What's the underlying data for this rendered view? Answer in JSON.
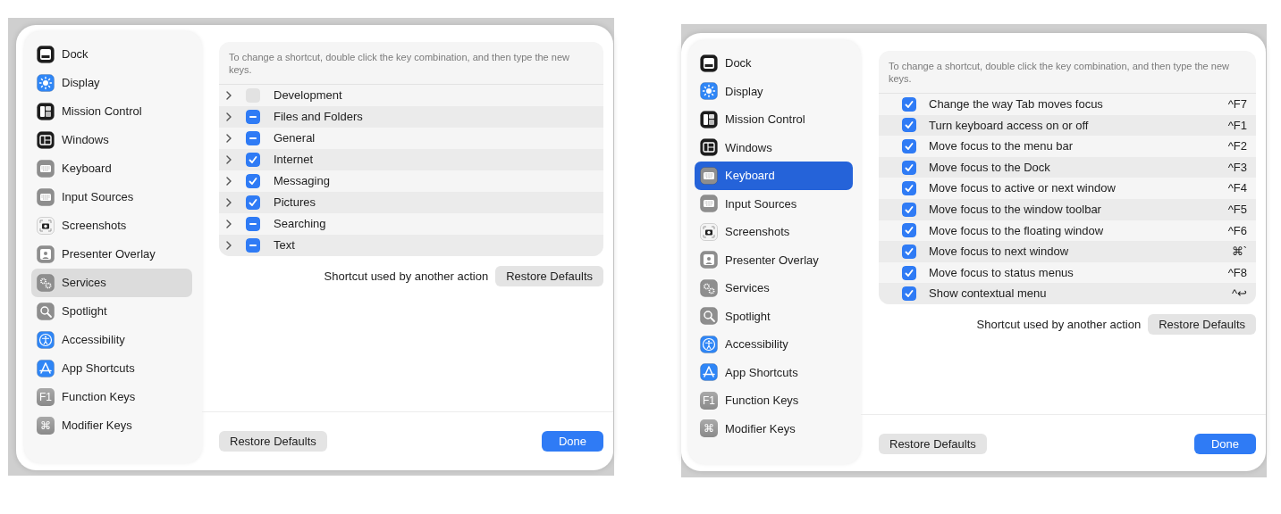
{
  "panels": [
    {
      "sidebar_focused": false,
      "sidebar": [
        {
          "label": "Dock",
          "selected": false
        },
        {
          "label": "Display",
          "selected": false
        },
        {
          "label": "Mission Control",
          "selected": false
        },
        {
          "label": "Windows",
          "selected": false
        },
        {
          "label": "Keyboard",
          "selected": false
        },
        {
          "label": "Input Sources",
          "selected": false
        },
        {
          "label": "Screenshots",
          "selected": false
        },
        {
          "label": "Presenter Overlay",
          "selected": false
        },
        {
          "label": "Services",
          "selected": true
        },
        {
          "label": "Spotlight",
          "selected": false
        },
        {
          "label": "Accessibility",
          "selected": false
        },
        {
          "label": "App Shortcuts",
          "selected": false
        },
        {
          "label": "Function Keys",
          "selected": false,
          "icon_glyph": "F1"
        },
        {
          "label": "Modifier Keys",
          "selected": false,
          "icon_glyph": "⌘"
        }
      ],
      "hint": "To change a shortcut, double click the key combination, and then type the new keys.",
      "rows": [
        {
          "kind": "group",
          "label": "Development",
          "checked": false,
          "mixed": false
        },
        {
          "kind": "group",
          "label": "Files and Folders",
          "checked": false,
          "mixed": true
        },
        {
          "kind": "group",
          "label": "General",
          "checked": false,
          "mixed": true
        },
        {
          "kind": "group",
          "label": "Internet",
          "checked": true,
          "mixed": false
        },
        {
          "kind": "group",
          "label": "Messaging",
          "checked": true,
          "mixed": false
        },
        {
          "kind": "group",
          "label": "Pictures",
          "checked": true,
          "mixed": false
        },
        {
          "kind": "group",
          "label": "Searching",
          "checked": false,
          "mixed": true
        },
        {
          "kind": "group",
          "label": "Text",
          "checked": false,
          "mixed": true
        }
      ],
      "footer_note": "Shortcut used by another action",
      "footer_button": "Restore Defaults",
      "bottom_left_button": "Restore Defaults",
      "done_button": "Done"
    },
    {
      "sidebar_focused": true,
      "sidebar": [
        {
          "label": "Dock",
          "selected": false
        },
        {
          "label": "Display",
          "selected": false
        },
        {
          "label": "Mission Control",
          "selected": false
        },
        {
          "label": "Windows",
          "selected": false
        },
        {
          "label": "Keyboard",
          "selected": true
        },
        {
          "label": "Input Sources",
          "selected": false
        },
        {
          "label": "Screenshots",
          "selected": false
        },
        {
          "label": "Presenter Overlay",
          "selected": false
        },
        {
          "label": "Services",
          "selected": false
        },
        {
          "label": "Spotlight",
          "selected": false
        },
        {
          "label": "Accessibility",
          "selected": false
        },
        {
          "label": "App Shortcuts",
          "selected": false
        },
        {
          "label": "Function Keys",
          "selected": false,
          "icon_glyph": "F1"
        },
        {
          "label": "Modifier Keys",
          "selected": false,
          "icon_glyph": "⌘"
        }
      ],
      "hint": "To change a shortcut, double click the key combination, and then type the new keys.",
      "rows": [
        {
          "kind": "shortcut",
          "label": "Change the way Tab moves focus",
          "checked": true,
          "mixed": false,
          "shortcut": "^F7"
        },
        {
          "kind": "shortcut",
          "label": "Turn keyboard access on or off",
          "checked": true,
          "mixed": false,
          "shortcut": "^F1"
        },
        {
          "kind": "shortcut",
          "label": "Move focus to the menu bar",
          "checked": true,
          "mixed": false,
          "shortcut": "^F2"
        },
        {
          "kind": "shortcut",
          "label": "Move focus to the Dock",
          "checked": true,
          "mixed": false,
          "shortcut": "^F3"
        },
        {
          "kind": "shortcut",
          "label": "Move focus to active or next window",
          "checked": true,
          "mixed": false,
          "shortcut": "^F4"
        },
        {
          "kind": "shortcut",
          "label": "Move focus to the window toolbar",
          "checked": true,
          "mixed": false,
          "shortcut": "^F5"
        },
        {
          "kind": "shortcut",
          "label": "Move focus to the floating window",
          "checked": true,
          "mixed": false,
          "shortcut": "^F6"
        },
        {
          "kind": "shortcut",
          "label": "Move focus to next window",
          "checked": true,
          "mixed": false,
          "shortcut": "⌘`"
        },
        {
          "kind": "shortcut",
          "label": "Move focus to status menus",
          "checked": true,
          "mixed": false,
          "shortcut": "^F8"
        },
        {
          "kind": "shortcut",
          "label": "Show contextual menu",
          "checked": true,
          "mixed": false,
          "shortcut": "^↩"
        }
      ],
      "footer_note": "Shortcut used by another action",
      "footer_button": "Restore Defaults",
      "bottom_left_button": "Restore Defaults",
      "done_button": "Done"
    }
  ]
}
